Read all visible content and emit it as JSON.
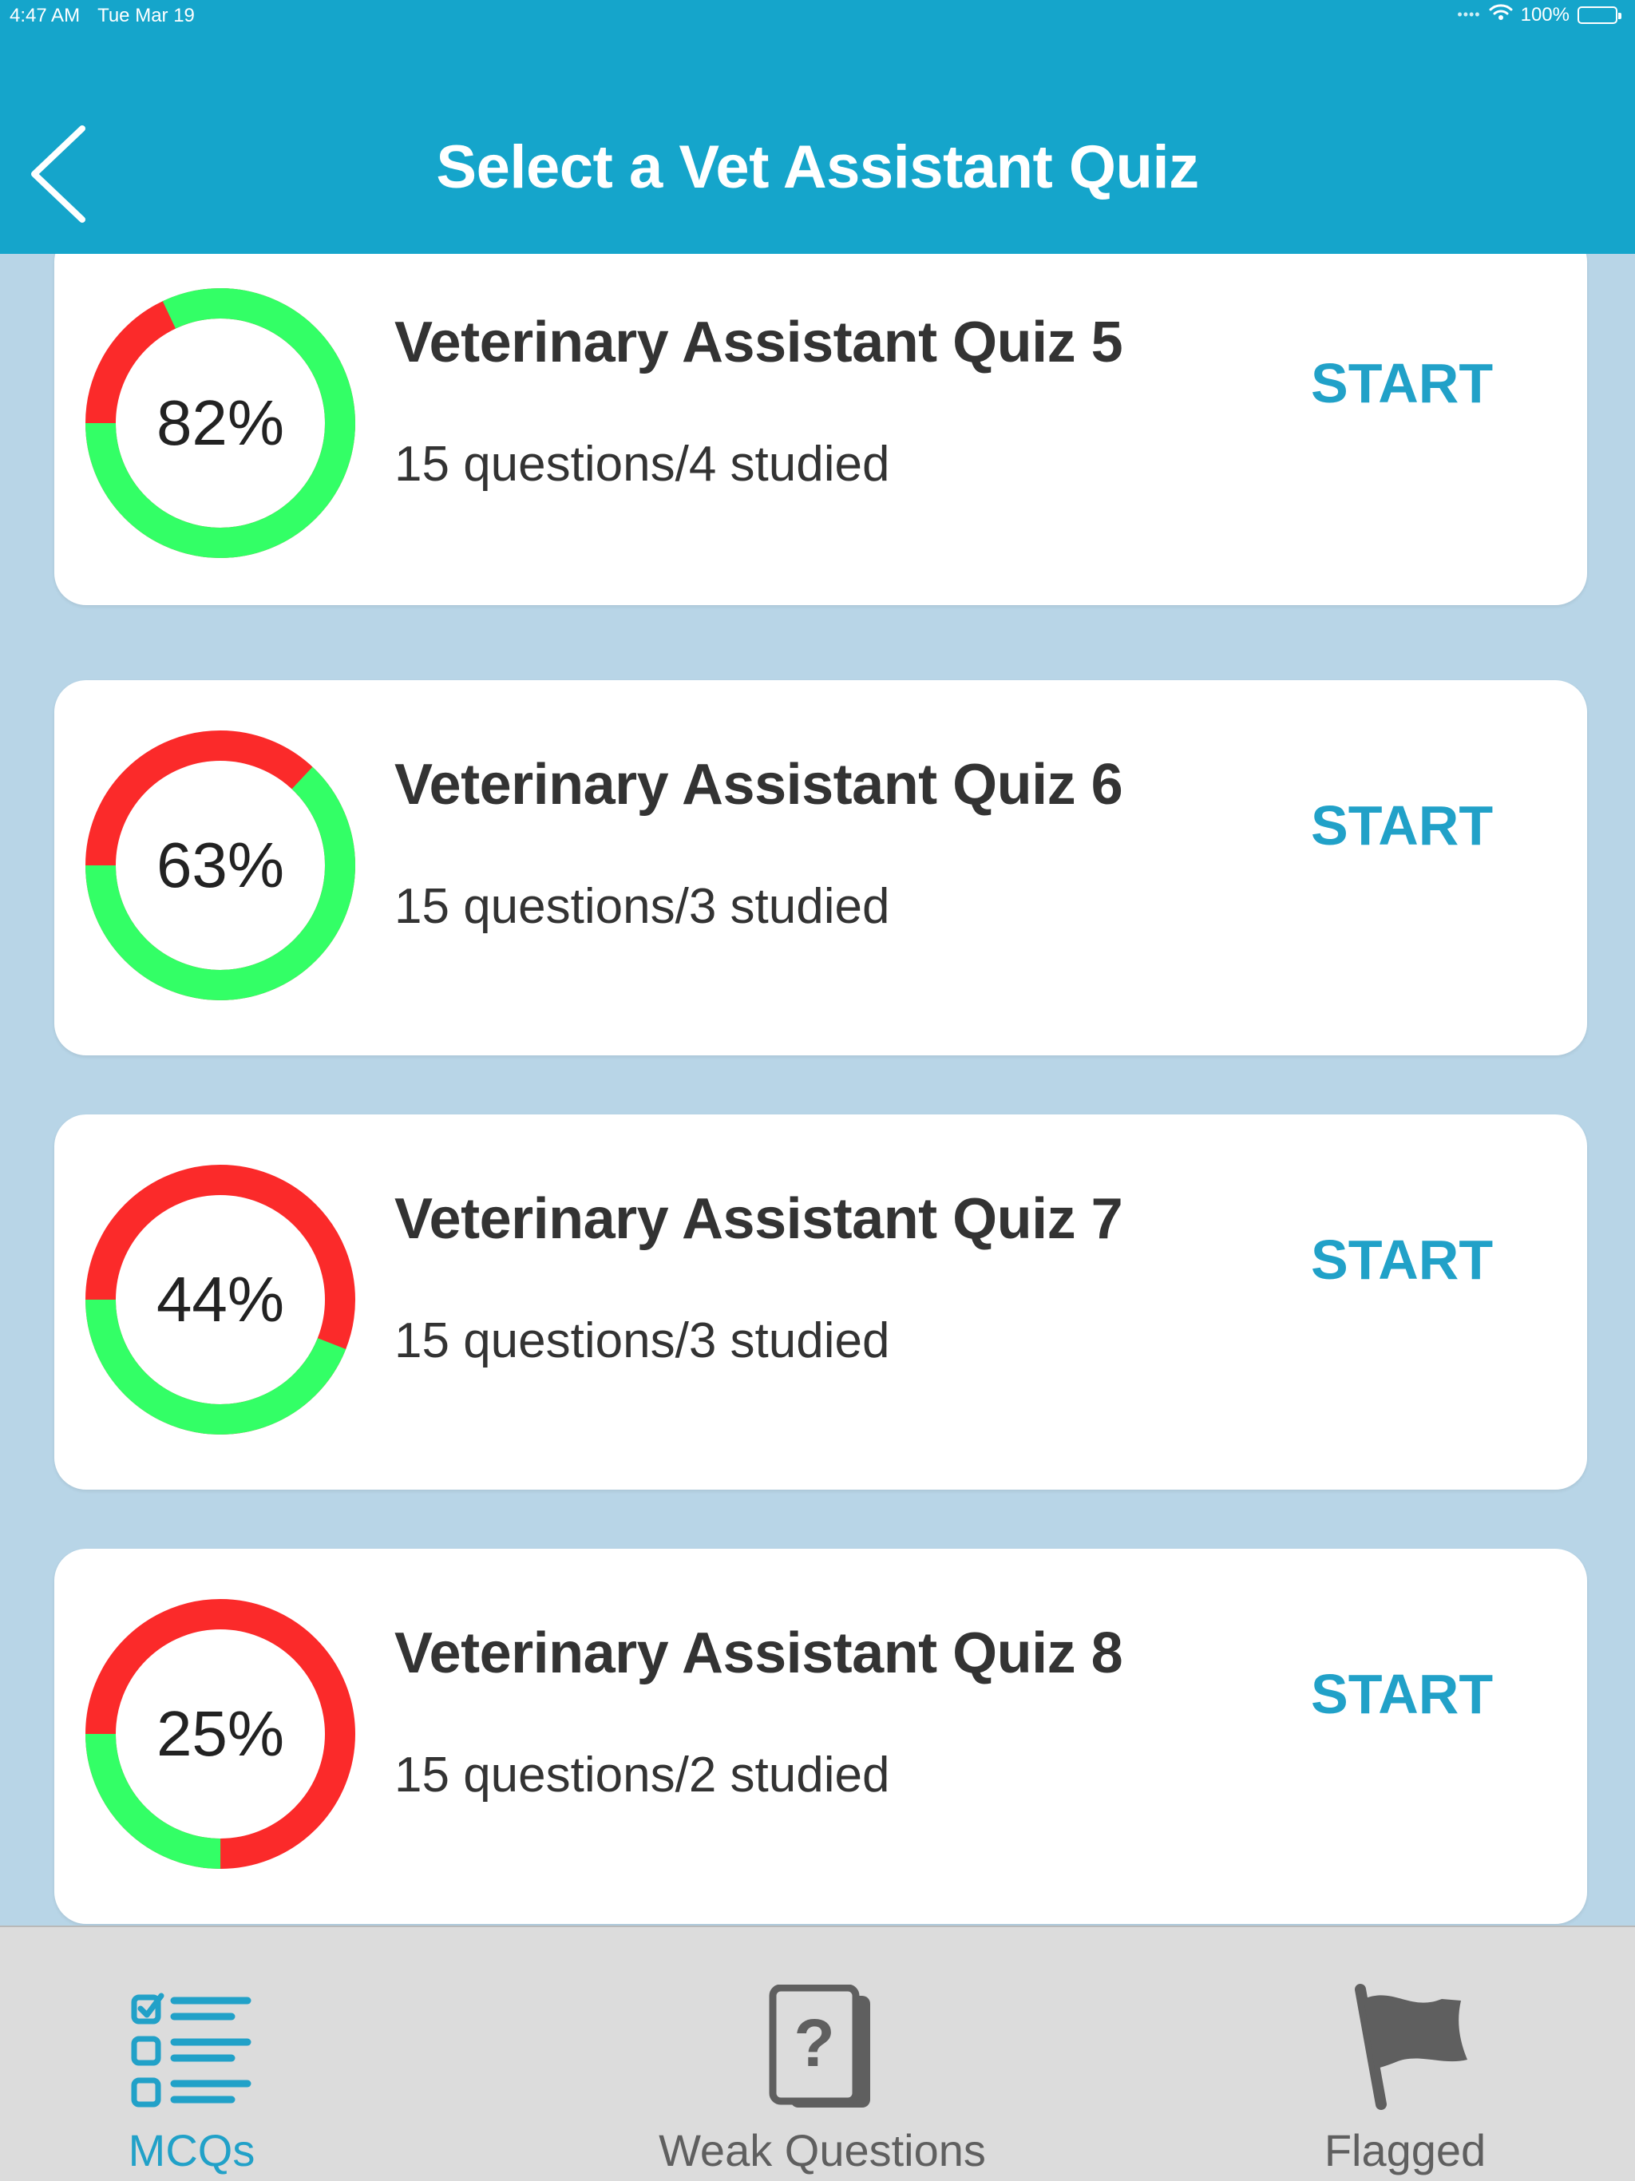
{
  "status_bar": {
    "time": "4:47 AM",
    "date": "Tue Mar 19",
    "battery": "100%"
  },
  "header": {
    "title": "Select a Vet Assistant Quiz"
  },
  "colors": {
    "header_bg": "#15a5cb",
    "page_bg": "#b8d5e7",
    "ring_correct": "#33ff66",
    "ring_incorrect": "#fb2a2a",
    "accent": "#21a1c8",
    "tab_inactive": "#5f5f5f"
  },
  "quizzes": [
    {
      "title": "Veterinary Assistant Quiz 5",
      "subtitle": "15 questions/4 studied",
      "percent_label": "82%",
      "score": 0.82,
      "start_label": "START"
    },
    {
      "title": "Veterinary Assistant Quiz 6",
      "subtitle": "15 questions/3 studied",
      "percent_label": "63%",
      "score": 0.63,
      "start_label": "START"
    },
    {
      "title": "Veterinary Assistant Quiz 7",
      "subtitle": "15 questions/3 studied",
      "percent_label": "44%",
      "score": 0.44,
      "start_label": "START"
    },
    {
      "title": "Veterinary Assistant Quiz 8",
      "subtitle": "15 questions/2 studied",
      "percent_label": "25%",
      "score": 0.25,
      "start_label": "START"
    }
  ],
  "tabs": [
    {
      "label": "MCQs",
      "icon": "checklist-icon",
      "active": true
    },
    {
      "label": "Weak Questions",
      "icon": "question-cards-icon",
      "active": false
    },
    {
      "label": "Flagged",
      "icon": "flag-icon",
      "active": false
    }
  ]
}
